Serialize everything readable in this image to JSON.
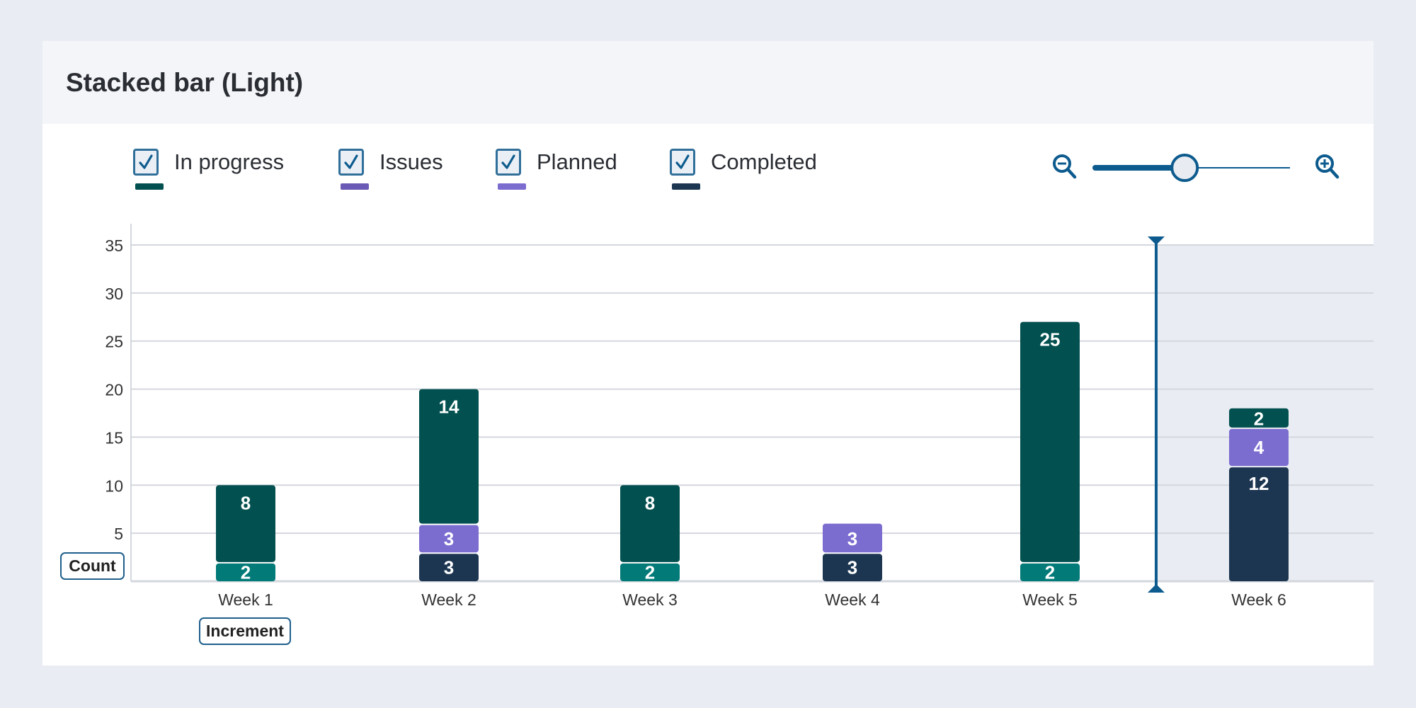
{
  "title": "Stacked bar (Light)",
  "legend": [
    {
      "label": "In progress",
      "color": "#02504f",
      "checked": true
    },
    {
      "label": "Issues",
      "color": "#6a5ab5",
      "checked": true
    },
    {
      "label": "Planned",
      "color": "#7b6cd0",
      "checked": true
    },
    {
      "label": "Completed",
      "color": "#1c3651",
      "checked": true
    }
  ],
  "zoom": {
    "out_icon": "zoom-out-icon",
    "in_icon": "zoom-in-icon",
    "level": 0.48,
    "accent": "#0d5b8e"
  },
  "axis_tags": {
    "y": "Count",
    "x": "Increment"
  },
  "chart_data": {
    "type": "bar",
    "stacked": true,
    "categories": [
      "Week 1",
      "Week 2",
      "Week 3",
      "Week 4",
      "Week 5",
      "Week 6"
    ],
    "series": [
      {
        "name": "Completed",
        "color": "#1c3651",
        "values": [
          0,
          3,
          0,
          3,
          0,
          12
        ]
      },
      {
        "color": "#017a78",
        "values": [
          2,
          0,
          2,
          0,
          2,
          0
        ]
      },
      {
        "name": "Planned",
        "color": "#7b6cd0",
        "values": [
          0,
          3,
          0,
          3,
          0,
          4
        ]
      },
      {
        "name": "In progress",
        "color": "#02504f",
        "values": [
          8,
          14,
          8,
          0,
          25,
          2
        ]
      }
    ],
    "ylabel": "Count",
    "xlabel": "Increment",
    "ylim": [
      0,
      35
    ],
    "yticks": [
      5,
      10,
      15,
      20,
      25,
      30,
      35
    ],
    "grid": true,
    "legend_position": "top-left",
    "highlight_from_category": "Week 6",
    "highlight_color": "#e9ecf3"
  }
}
